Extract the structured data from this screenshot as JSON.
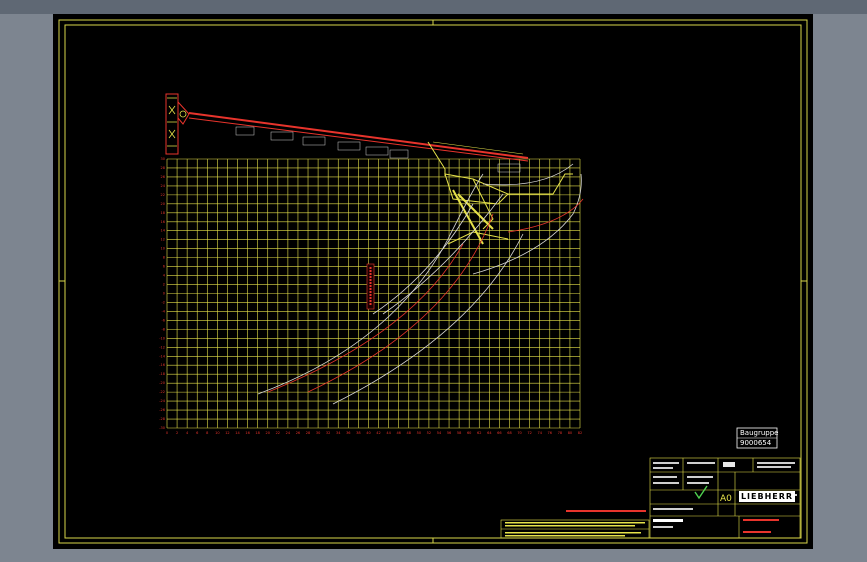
{
  "window": {
    "title": ""
  },
  "sheet": {
    "background": "#000000",
    "frame_color": "#d8d64a",
    "grid_color": "#e6e24a",
    "red_color": "#e8342c"
  },
  "stamp": {
    "group_label": "Baugruppe",
    "group_number": "9000654"
  },
  "title_block": {
    "format": "A0",
    "revision_mark": "√",
    "company": "LIEBHERR"
  },
  "notes": {
    "red_note": "Arbeitsbereichsdiagramm"
  },
  "x_axis_ticks": [
    "0",
    "2",
    "4",
    "6",
    "8",
    "10",
    "12",
    "14",
    "16",
    "18",
    "20",
    "22",
    "24",
    "26",
    "28",
    "30",
    "32",
    "34",
    "36",
    "38",
    "40",
    "42",
    "44",
    "46",
    "48",
    "50",
    "52",
    "54",
    "56",
    "58",
    "60",
    "62",
    "64",
    "66",
    "68",
    "70",
    "72",
    "74",
    "76",
    "78",
    "80",
    "82"
  ],
  "y_axis_ticks": [
    "30",
    "28",
    "26",
    "24",
    "22",
    "20",
    "18",
    "16",
    "14",
    "12",
    "10",
    "8",
    "6",
    "4",
    "2",
    "0",
    "-2",
    "-4",
    "-6",
    "-8",
    "-10",
    "-12",
    "-14",
    "-16",
    "-18",
    "-20",
    "-22",
    "-24",
    "-26",
    "-28",
    "-30"
  ]
}
